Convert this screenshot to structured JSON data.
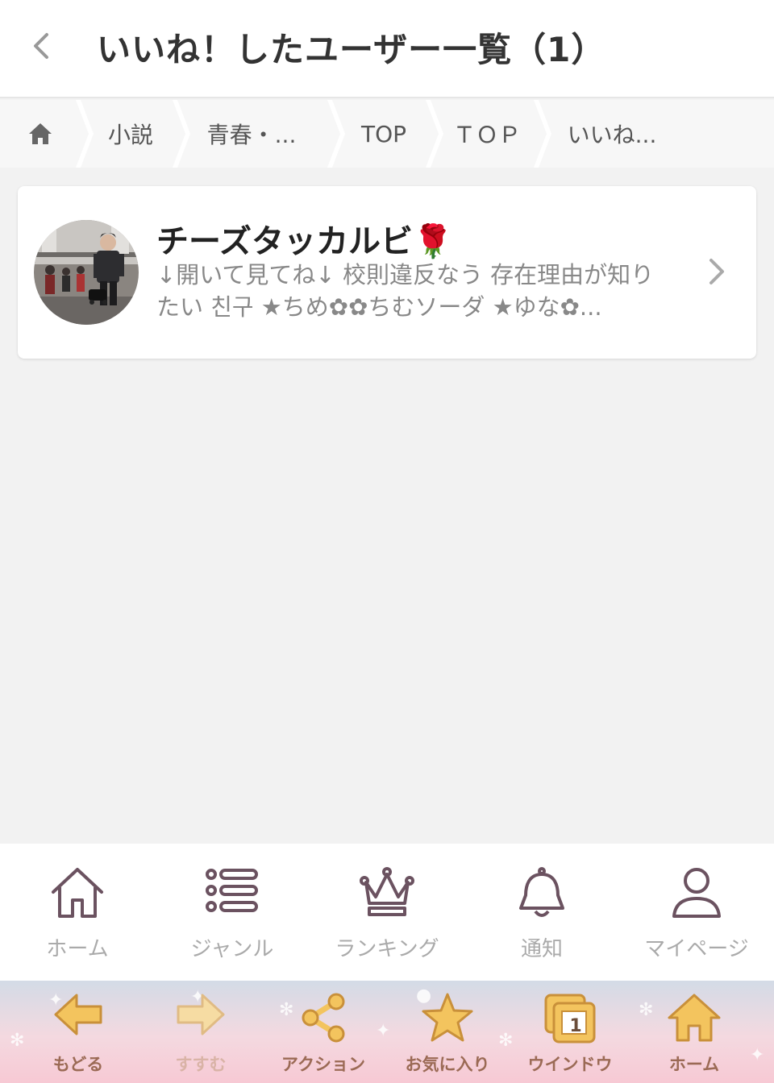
{
  "header": {
    "title": "いいね！したユーザー一覧（1）"
  },
  "breadcrumb": {
    "items": [
      "小説",
      "青春・...",
      "TOP",
      "ＴＯＰ",
      "いいね..."
    ]
  },
  "user": {
    "name": "チーズタッカルビ🌹",
    "bio": "↓開いて見てね↓ 校則違反なう 存在理由が知りたい 친구 ★ちめ✿✿ちむソーダ ★ゆな✿..."
  },
  "bottom_nav": {
    "items": [
      {
        "label": "ホーム",
        "icon": "home-icon"
      },
      {
        "label": "ジャンル",
        "icon": "list-icon"
      },
      {
        "label": "ランキング",
        "icon": "crown-icon"
      },
      {
        "label": "通知",
        "icon": "bell-icon"
      },
      {
        "label": "マイページ",
        "icon": "person-icon"
      }
    ]
  },
  "toolbar": {
    "items": [
      {
        "label": "もどる",
        "icon": "arrow-left-icon"
      },
      {
        "label": "すすむ",
        "icon": "arrow-right-icon"
      },
      {
        "label": "アクション",
        "icon": "share-icon"
      },
      {
        "label": "お気に入り",
        "icon": "star-icon"
      },
      {
        "label": "ウインドウ",
        "icon": "window-icon",
        "badge": "1"
      },
      {
        "label": "ホーム",
        "icon": "home-icon"
      }
    ]
  },
  "colors": {
    "icon_dark": "#6b5260",
    "nav_label": "#aaaaaa",
    "toolbar_label": "#9b6a55",
    "toolbar_icon": "#f3c45e"
  }
}
